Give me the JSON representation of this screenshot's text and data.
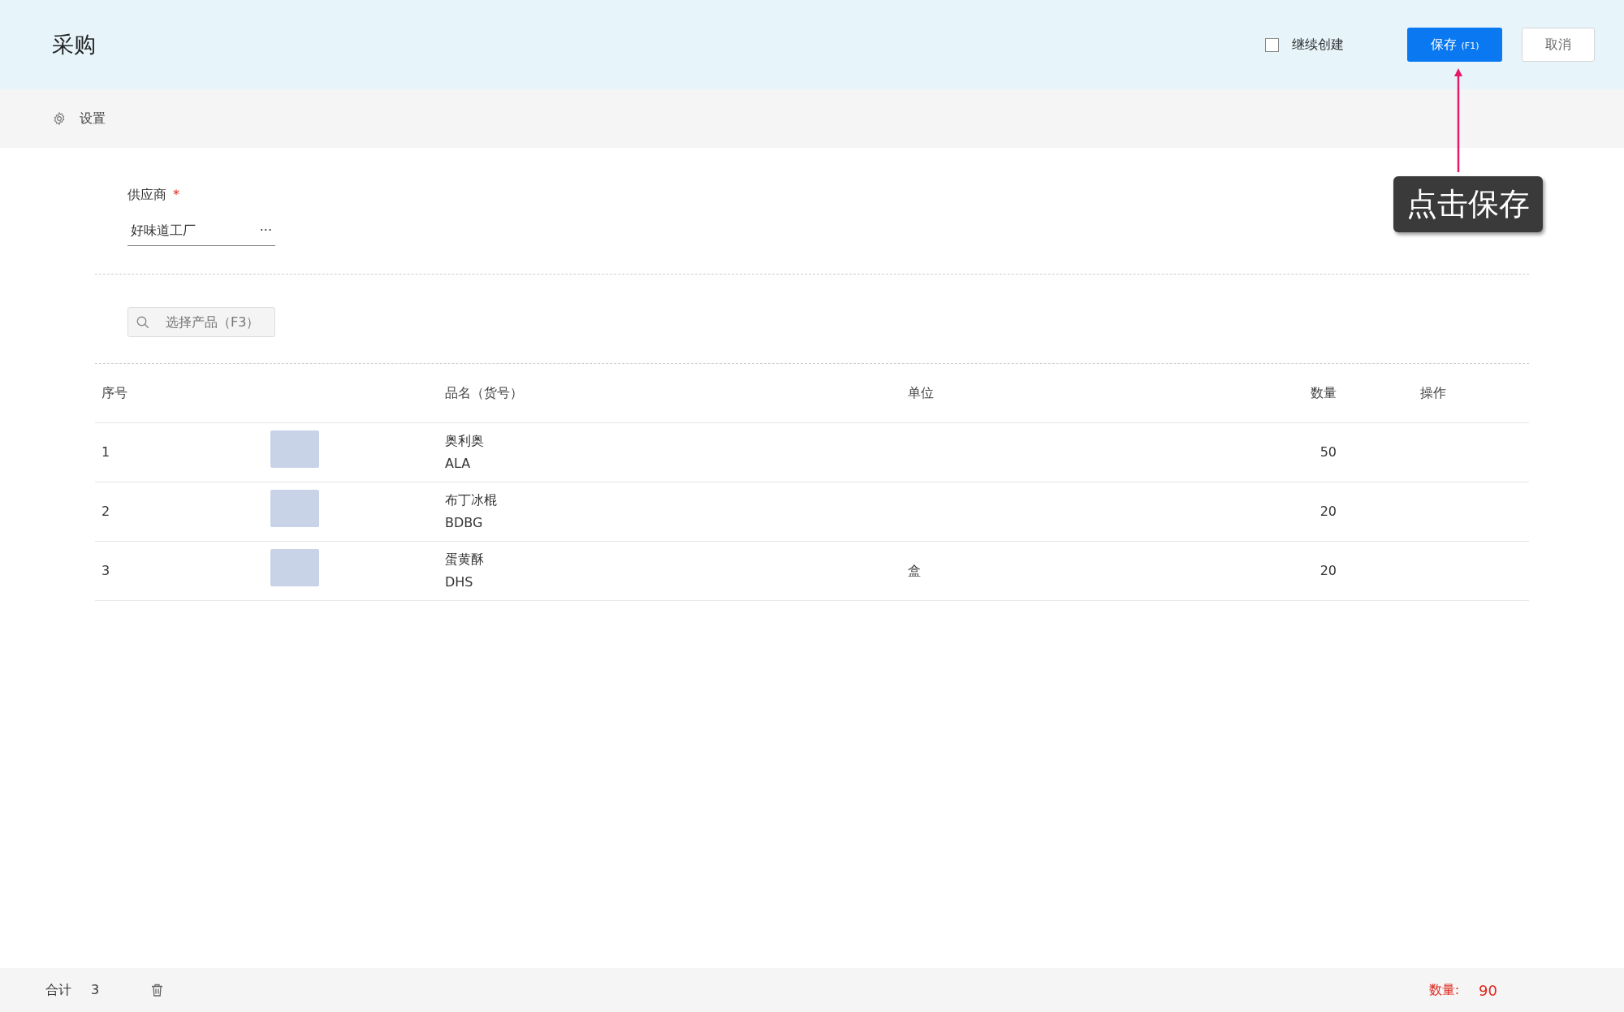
{
  "header": {
    "title": "采购",
    "continue_create": {
      "label": "继续创建",
      "checked": false
    },
    "save_button": {
      "label": "保存",
      "shortcut": "(F1)"
    },
    "cancel_button": "取消"
  },
  "callout": "点击保存",
  "settings": "设置",
  "supplier": {
    "label": "供应商",
    "required_mark": "*",
    "value": "好味道工厂",
    "more": "···"
  },
  "product_search": {
    "placeholder": "选择产品（F3）"
  },
  "table": {
    "columns": [
      "序号",
      "品名（货号）",
      "单位",
      "数量",
      "操作"
    ],
    "rows": [
      {
        "index": "1",
        "name": "奥利奥",
        "code": "ALA",
        "quantity": "50"
      },
      {
        "index": "2",
        "name": "布丁冰棍",
        "code": "BDBG",
        "quantity": "20"
      },
      {
        "index": "3",
        "name": "蛋黄酥",
        "code": "DHS",
        "unit": "盒",
        "quantity": "20"
      }
    ]
  },
  "footer": {
    "total_label": "合计",
    "total_count": "3",
    "quantity_label": "数量:",
    "quantity_value": "90"
  }
}
